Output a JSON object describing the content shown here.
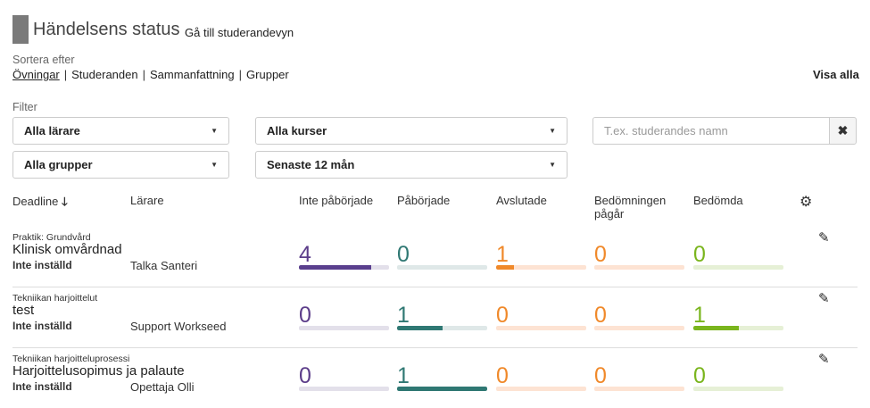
{
  "header": {
    "title": "Händelsens status",
    "student_view_link": "Gå till studerandevyn"
  },
  "sort": {
    "label": "Sortera efter",
    "options": [
      "Övningar",
      "Studeranden",
      "Sammanfattning",
      "Grupper"
    ],
    "active": "Övningar"
  },
  "show_all": "Visa alla",
  "filter": {
    "label": "Filter",
    "teachers": "Alla lärare",
    "courses": "Alla kurser",
    "groups": "Alla grupper",
    "period": "Senaste 12 mån",
    "search_placeholder": "T.ex. studerandes namn",
    "clear_icon": "✖"
  },
  "columns": {
    "deadline": "Deadline",
    "teacher": "Lärare",
    "not_started": "Inte påbörjade",
    "started": "Påbörjade",
    "completed": "Avslutade",
    "assessment": "Bedömningen pågår",
    "assessed": "Bedömda"
  },
  "status_colors": {
    "not_started": {
      "text": "#5c3d8a",
      "bar": "#5a3f8e",
      "track": "#e3e0ea"
    },
    "started": {
      "text": "#2f7873",
      "bar": "#2f7873",
      "track": "#dfe8e8"
    },
    "completed": {
      "text": "#f0892a",
      "bar": "#f0892a",
      "track": "#fde3d3"
    },
    "assessment": {
      "text": "#f0892a",
      "bar": "#f0892a",
      "track": "#fde3d3"
    },
    "assessed": {
      "text": "#7ab51d",
      "bar": "#7ab51d",
      "track": "#e6f0d6"
    }
  },
  "rows": [
    {
      "category": "Praktik: Grundvård",
      "title": "Klinisk omvårdnad",
      "deadline": "Inte inställd",
      "teacher": "Talka Santeri",
      "counts": {
        "not_started": "4",
        "started": "0",
        "completed": "1",
        "assessment": "0",
        "assessed": "0"
      },
      "fractions": {
        "not_started": 0.8,
        "started": 0,
        "completed": 0.2,
        "assessment": 0,
        "assessed": 0
      }
    },
    {
      "category": "Tekniikan harjoittelut",
      "title": "test",
      "deadline": "Inte inställd",
      "teacher": "Support Workseed",
      "counts": {
        "not_started": "0",
        "started": "1",
        "completed": "0",
        "assessment": "0",
        "assessed": "1"
      },
      "fractions": {
        "not_started": 0,
        "started": 0.5,
        "completed": 0,
        "assessment": 0,
        "assessed": 0.5
      }
    },
    {
      "category": "Tekniikan harjoitteluprosessi",
      "title": "Harjoittelusopimus ja palaute",
      "deadline": "Inte inställd",
      "teacher": "Opettaja Olli",
      "counts": {
        "not_started": "0",
        "started": "1",
        "completed": "0",
        "assessment": "0",
        "assessed": "0"
      },
      "fractions": {
        "not_started": 0,
        "started": 1,
        "completed": 0,
        "assessment": 0,
        "assessed": 0
      }
    }
  ]
}
